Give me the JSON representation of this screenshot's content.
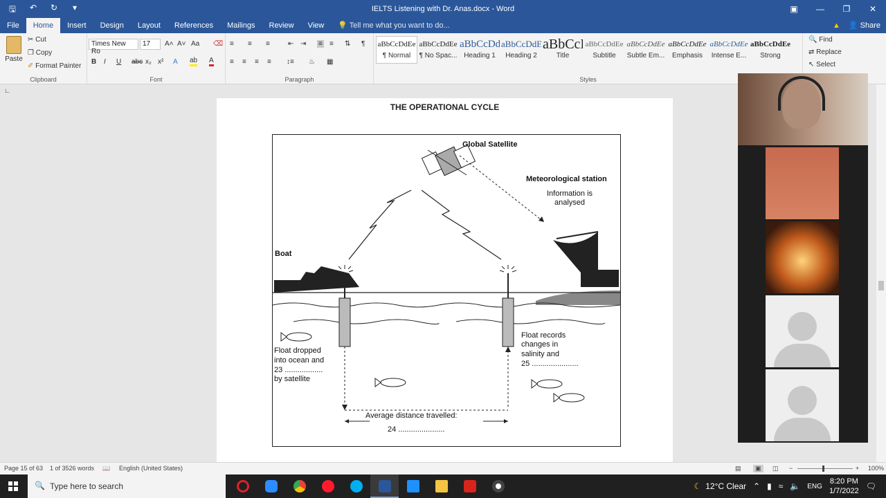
{
  "window": {
    "title": "IELTS Listening with Dr. Anas.docx  -  Word"
  },
  "tabs": [
    "File",
    "Home",
    "Insert",
    "Design",
    "Layout",
    "References",
    "Mailings",
    "Review",
    "View"
  ],
  "tell_me": "Tell me what you want to do...",
  "share_label": "Share",
  "clipboard": {
    "paste": "Paste",
    "cut": "Cut",
    "copy": "Copy",
    "format_painter": "Format Painter",
    "label": "Clipboard"
  },
  "font": {
    "name": "Times New Ro",
    "size": "17",
    "label": "Font",
    "bold": "B",
    "italic": "I",
    "underline": "U",
    "strike": "abc",
    "subscript": "x₂",
    "superscript": "x²"
  },
  "paragraph": {
    "label": "Paragraph",
    "pilcrow": "¶"
  },
  "styles": {
    "label": "Styles",
    "items": [
      {
        "preview": "aBbCcDdEe",
        "name": "¶ Normal"
      },
      {
        "preview": "aBbCcDdEe",
        "name": "¶ No Spac..."
      },
      {
        "preview": "aBbCcDdEe",
        "name": "Heading 1"
      },
      {
        "preview": "aBbCcDdEe",
        "name": "Heading 2"
      },
      {
        "preview": "aBbCcDdEe",
        "name": "Title"
      },
      {
        "preview": "aBbCcDdEe",
        "name": "Subtitle"
      },
      {
        "preview": "aBbCcDdEe",
        "name": "Subtle Em..."
      },
      {
        "preview": "aBbCcDdEe",
        "name": "Emphasis"
      },
      {
        "preview": "aBbCcDdEe",
        "name": "Intense E..."
      },
      {
        "preview": "aBbCcDdEe",
        "name": "Strong"
      }
    ]
  },
  "editing": {
    "find": "Find",
    "replace": "Replace",
    "select": "Select"
  },
  "document": {
    "heading": "THE OPERATIONAL CYCLE",
    "labels": {
      "global_satellite": "Global Satellite",
      "met_station": "Meteorological station",
      "info_analysed": "Information is analysed",
      "boat": "Boat",
      "float_dropped_1": "Float dropped",
      "float_dropped_2": "into ocean and",
      "float_dropped_3": "23 ..................",
      "float_dropped_4": "by satellite",
      "float_records_1": "Float records",
      "float_records_2": "changes in",
      "float_records_3": "salinity and",
      "float_records_4": "25 ......................",
      "avg_distance": "Average distance travelled:",
      "q24": "24 ......................"
    }
  },
  "status": {
    "page": "Page 15 of 63",
    "words": "1 of 3526 words",
    "language": "English (United States)",
    "zoom": "100%"
  },
  "taskbar": {
    "search_placeholder": "Type here to search",
    "weather": "12°C  Clear",
    "time": "8:20 PM",
    "date": "1/7/2022",
    "lang": "ENG"
  }
}
